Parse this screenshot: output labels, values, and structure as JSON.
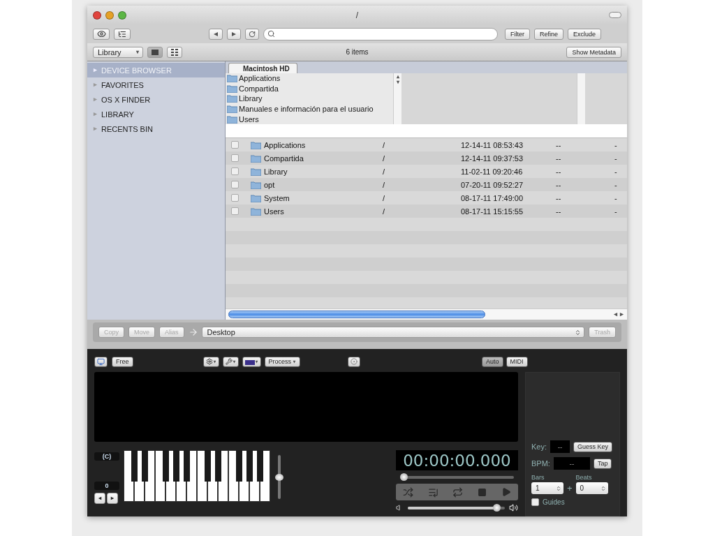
{
  "window": {
    "title": "/"
  },
  "filter_buttons": [
    "Filter",
    "Refine",
    "Exclude"
  ],
  "location_bar": {
    "source": "Library",
    "item_count": "6 items",
    "metadata_button": "Show Metadata",
    "views": [
      {
        "kind": "list",
        "selected": true
      },
      {
        "kind": "grid",
        "selected": false
      }
    ]
  },
  "sidebar": {
    "items": [
      {
        "label": "DEVICE BROWSER",
        "selected": true
      },
      {
        "label": "FAVORITES",
        "selected": false
      },
      {
        "label": "OS X FINDER",
        "selected": false
      },
      {
        "label": "LIBRARY",
        "selected": false
      },
      {
        "label": "RECENTS BIN",
        "selected": false
      }
    ]
  },
  "browser": {
    "tabs": [
      {
        "label": "Macintosh HD",
        "selected": true
      }
    ],
    "column": [
      "Applications",
      "Compartida",
      "Library",
      "Manuales e información para el usuario",
      "Users"
    ]
  },
  "files": {
    "rows": [
      {
        "name": "Applications",
        "path": "/",
        "modified": "12-14-11 08:53:43",
        "column_4": "--",
        "column_5": "-",
        "checked": false
      },
      {
        "name": "Compartida",
        "path": "/",
        "modified": "12-14-11 09:37:53",
        "column_4": "--",
        "column_5": "-",
        "checked": false
      },
      {
        "name": "Library",
        "path": "/",
        "modified": "11-02-11 09:20:46",
        "column_4": "--",
        "column_5": "-",
        "checked": false
      },
      {
        "name": "opt",
        "path": "/",
        "modified": "07-20-11 09:52:27",
        "column_4": "--",
        "column_5": "-",
        "checked": false
      },
      {
        "name": "System",
        "path": "/",
        "modified": "08-17-11 17:49:00",
        "column_4": "--",
        "column_5": "-",
        "checked": false
      },
      {
        "name": "Users",
        "path": "/",
        "modified": "08-17-11 15:15:55",
        "column_4": "--",
        "column_5": "-",
        "checked": false
      }
    ]
  },
  "actions": {
    "buttons": [
      {
        "label": "Copy",
        "disabled": true
      },
      {
        "label": "Move",
        "disabled": true
      },
      {
        "label": "Alias",
        "disabled": true
      }
    ],
    "destination": "Desktop",
    "trash": {
      "label": "Trash",
      "disabled": true
    }
  },
  "player": {
    "free_button": "Free",
    "process_button": "Process",
    "toggles": [
      {
        "label": "Auto",
        "selected": true
      },
      {
        "label": "MIDI",
        "selected": false
      }
    ],
    "key_name": "(C)",
    "octave": "0",
    "pitch": {
      "level": 0.5
    },
    "time": "00:00:00.000",
    "position": {
      "level": 0
    },
    "volume": {
      "level": 0.95
    },
    "key": {
      "label": "Key:",
      "value": "--",
      "button": "Guess Key"
    },
    "bpm": {
      "label": "BPM:",
      "value": "--",
      "button": "Tap"
    },
    "bars": {
      "label": "Bars",
      "value": "1"
    },
    "plus": "+",
    "beats": {
      "label": "Beats",
      "value": "0"
    },
    "guides": {
      "label": "Guides",
      "checked": false
    }
  }
}
